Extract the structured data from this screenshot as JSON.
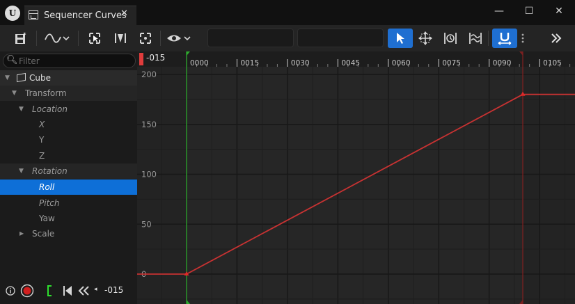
{
  "window": {
    "tab_title": "Sequencer Curves",
    "tab_close": "✕",
    "minimize": "—",
    "maximize": "☐",
    "close": "✕"
  },
  "filter": {
    "placeholder": "Filter"
  },
  "tree": [
    {
      "label": "Cube"
    },
    {
      "label": "Transform"
    },
    {
      "label": "Location"
    },
    {
      "label": "X"
    },
    {
      "label": "Y"
    },
    {
      "label": "Z"
    },
    {
      "label": "Rotation"
    },
    {
      "label": "Roll"
    },
    {
      "label": "Pitch"
    },
    {
      "label": "Yaw"
    },
    {
      "label": "Scale"
    }
  ],
  "playback": {
    "current_frame": "-015"
  },
  "timeline": {
    "current_frame_label": "-015",
    "ticks": [
      "0000",
      "0015",
      "0030",
      "0045",
      "0060",
      "0075",
      "0090",
      "0105"
    ]
  },
  "chart_data": {
    "type": "line",
    "x_ticks": [
      0,
      15,
      30,
      45,
      60,
      75,
      90,
      105
    ],
    "y_ticks": [
      0,
      50,
      100,
      150,
      200
    ],
    "y_tick_labels": [
      "0",
      "50",
      "100",
      "150",
      "200"
    ],
    "series": [
      {
        "points": [
          [
            -30,
            0
          ],
          [
            0,
            0
          ],
          [
            100,
            180
          ],
          [
            120,
            180
          ]
        ],
        "keys": [
          [
            0,
            0
          ],
          [
            100,
            180
          ]
        ],
        "color": "#c83232"
      }
    ],
    "playback_range": {
      "start": 0,
      "end": 100
    },
    "current_frame": -15
  },
  "colors": {
    "accent": "#0e6fd7",
    "curve": "#c83232",
    "playback_start": "#2eaa2e",
    "playback_end": "#7a2020"
  }
}
